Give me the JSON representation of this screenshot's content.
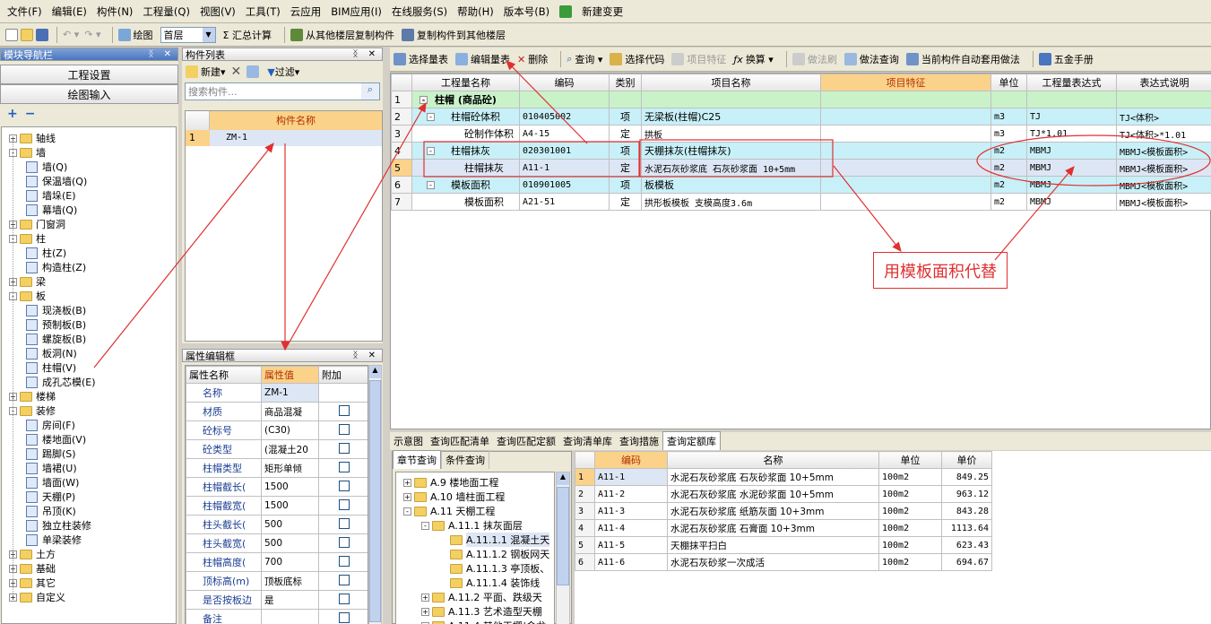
{
  "menu": {
    "items": [
      "文件(F)",
      "编辑(E)",
      "构件(N)",
      "工程量(Q)",
      "视图(V)",
      "工具(T)",
      "云应用",
      "BIM应用(I)",
      "在线服务(S)",
      "帮助(H)",
      "版本号(B)"
    ],
    "new_change": "新建变更"
  },
  "toolbar": {
    "draw": "绘图",
    "floor": "首层",
    "sum": "Σ 汇总计算",
    "copy_from": "从其他楼层复制构件",
    "copy_to": "复制构件到其他楼层"
  },
  "nav": {
    "title": "模块导航栏",
    "settings_btn": "工程设置",
    "draw_btn": "绘图输入",
    "tree": [
      {
        "label": "轴线",
        "level": 0,
        "type": "folder",
        "expander": "+"
      },
      {
        "label": "墙",
        "level": 0,
        "type": "folder",
        "expander": "-"
      },
      {
        "label": "墙(Q)",
        "level": 1,
        "type": "leaf"
      },
      {
        "label": "保温墙(Q)",
        "level": 1,
        "type": "leaf"
      },
      {
        "label": "墙垛(E)",
        "level": 1,
        "type": "leaf"
      },
      {
        "label": "幕墙(Q)",
        "level": 1,
        "type": "leaf"
      },
      {
        "label": "门窗洞",
        "level": 0,
        "type": "folder",
        "expander": "+"
      },
      {
        "label": "柱",
        "level": 0,
        "type": "folder",
        "expander": "-"
      },
      {
        "label": "柱(Z)",
        "level": 1,
        "type": "leaf"
      },
      {
        "label": "构造柱(Z)",
        "level": 1,
        "type": "leaf"
      },
      {
        "label": "梁",
        "level": 0,
        "type": "folder",
        "expander": "+"
      },
      {
        "label": "板",
        "level": 0,
        "type": "folder",
        "expander": "-"
      },
      {
        "label": "现浇板(B)",
        "level": 1,
        "type": "leaf"
      },
      {
        "label": "预制板(B)",
        "level": 1,
        "type": "leaf"
      },
      {
        "label": "螺旋板(B)",
        "level": 1,
        "type": "leaf"
      },
      {
        "label": "板洞(N)",
        "level": 1,
        "type": "leaf"
      },
      {
        "label": "柱帽(V)",
        "level": 1,
        "type": "leaf"
      },
      {
        "label": "成孔芯模(E)",
        "level": 1,
        "type": "leaf"
      },
      {
        "label": "楼梯",
        "level": 0,
        "type": "folder",
        "expander": "+"
      },
      {
        "label": "装修",
        "level": 0,
        "type": "folder",
        "expander": "-"
      },
      {
        "label": "房间(F)",
        "level": 1,
        "type": "leaf"
      },
      {
        "label": "楼地面(V)",
        "level": 1,
        "type": "leaf"
      },
      {
        "label": "踢脚(S)",
        "level": 1,
        "type": "leaf"
      },
      {
        "label": "墙裙(U)",
        "level": 1,
        "type": "leaf"
      },
      {
        "label": "墙面(W)",
        "level": 1,
        "type": "leaf"
      },
      {
        "label": "天棚(P)",
        "level": 1,
        "type": "leaf"
      },
      {
        "label": "吊顶(K)",
        "level": 1,
        "type": "leaf"
      },
      {
        "label": "独立柱装修",
        "level": 1,
        "type": "leaf"
      },
      {
        "label": "单梁装修",
        "level": 1,
        "type": "leaf"
      },
      {
        "label": "土方",
        "level": 0,
        "type": "folder",
        "expander": "+"
      },
      {
        "label": "基础",
        "level": 0,
        "type": "folder",
        "expander": "+"
      },
      {
        "label": "其它",
        "level": 0,
        "type": "folder",
        "expander": "+"
      },
      {
        "label": "自定义",
        "level": 0,
        "type": "folder",
        "expander": "+"
      }
    ]
  },
  "component_list": {
    "title": "构件列表",
    "new": "新建",
    "filter": "过滤",
    "search_placeholder": "搜索构件...",
    "col_header": "构件名称",
    "rows": [
      {
        "idx": "1",
        "name": "ZM-1"
      }
    ]
  },
  "properties": {
    "title": "属性编辑框",
    "headers": [
      "属性名称",
      "属性值",
      "附加"
    ],
    "rows": [
      {
        "name": "名称",
        "value": "ZM-1",
        "check": false
      },
      {
        "name": "材质",
        "value": "商品混凝",
        "check": true
      },
      {
        "name": "砼标号",
        "value": "(C30)",
        "check": true
      },
      {
        "name": "砼类型",
        "value": "(混凝土20",
        "check": true
      },
      {
        "name": "柱帽类型",
        "value": "矩形单倾",
        "check": true
      },
      {
        "name": "柱帽截长(",
        "value": "1500",
        "check": true
      },
      {
        "name": "柱帽截宽(",
        "value": "1500",
        "check": true
      },
      {
        "name": "柱头截长(",
        "value": "500",
        "check": true
      },
      {
        "name": "柱头截宽(",
        "value": "500",
        "check": true
      },
      {
        "name": "柱帽高度(",
        "value": "700",
        "check": true
      },
      {
        "name": "顶标高(m)",
        "value": "顶板底标",
        "check": true
      },
      {
        "name": "是否按板边",
        "value": "是",
        "check": true
      },
      {
        "name": "备注",
        "value": "",
        "check": true
      }
    ]
  },
  "quantity_toolbar": {
    "select_list": "选择量表",
    "edit_list": "编辑量表",
    "delete": "删除",
    "query": "查询",
    "select_code": "选择代码",
    "item_feature": "项目特征",
    "convert": "换算",
    "format_brush": "做法刷",
    "method_query": "做法查询",
    "auto_apply": "当前构件自动套用做法",
    "hardware": "五金手册"
  },
  "quantity_table": {
    "headers": [
      "",
      "工程量名称",
      "编码",
      "类别",
      "项目名称",
      "项目特征",
      "单位",
      "工程量表达式",
      "表达式说明"
    ],
    "rows": [
      {
        "idx": "1",
        "name": "柱帽 (商品砼)",
        "code": "",
        "type": "",
        "item": "",
        "feature": "",
        "unit": "",
        "expr": "",
        "desc": "",
        "style": "group"
      },
      {
        "idx": "2",
        "name": "柱帽砼体积",
        "code": "010405002",
        "type": "项",
        "item": "无梁板(柱帽)C25",
        "feature": "",
        "unit": "m3",
        "expr": "TJ",
        "desc": "TJ<体积>",
        "style": "item"
      },
      {
        "idx": "3",
        "name": "砼制作体积",
        "code": "A4-15",
        "type": "定",
        "item": "拱板",
        "feature": "",
        "unit": "m3",
        "expr": "TJ*1.01",
        "desc": "TJ<体积>*1.01",
        "style": "quota"
      },
      {
        "idx": "4",
        "name": "柱帽抹灰",
        "code": "020301001",
        "type": "项",
        "item": "天棚抹灰(柱帽抹灰)",
        "feature": "",
        "unit": "m2",
        "expr": "MBMJ",
        "desc": "MBMJ<模板面积>",
        "style": "item"
      },
      {
        "idx": "5",
        "name": "柱帽抹灰",
        "code": "A11-1",
        "type": "定",
        "item": "水泥石灰砂浆底 石灰砂浆面 10+5mm",
        "feature": "",
        "unit": "m2",
        "expr": "MBMJ",
        "desc": "MBMJ<模板面积>",
        "style": "selected"
      },
      {
        "idx": "6",
        "name": "模板面积",
        "code": "010901005",
        "type": "项",
        "item": "板模板",
        "feature": "",
        "unit": "m2",
        "expr": "MBMJ",
        "desc": "MBMJ<模板面积>",
        "style": "item"
      },
      {
        "idx": "7",
        "name": "模板面积",
        "code": "A21-51",
        "type": "定",
        "item": "拱形板模板 支模高度3.6m",
        "feature": "",
        "unit": "m2",
        "expr": "MBMJ",
        "desc": "MBMJ<模板面积>",
        "style": "quota"
      }
    ]
  },
  "annotation": {
    "text": "用模板面积代替"
  },
  "bottom_tabs": [
    "示意图",
    "查询匹配清单",
    "查询匹配定额",
    "查询清单库",
    "查询措施",
    "查询定额库"
  ],
  "chapter": {
    "tabs": [
      "章节查询",
      "条件查询"
    ],
    "tree": [
      {
        "label": "A.9 楼地面工程",
        "level": 0,
        "expander": "+"
      },
      {
        "label": "A.10 墙柱面工程",
        "level": 0,
        "expander": "+"
      },
      {
        "label": "A.11 天棚工程",
        "level": 0,
        "expander": "-"
      },
      {
        "label": "A.11.1 抹灰面层",
        "level": 1,
        "expander": "-"
      },
      {
        "label": "A.11.1.1 混凝土天",
        "level": 2,
        "expander": "",
        "selected": true
      },
      {
        "label": "A.11.1.2 钢板网天",
        "level": 2,
        "expander": ""
      },
      {
        "label": "A.11.1.3 亭顶板、",
        "level": 2,
        "expander": ""
      },
      {
        "label": "A.11.1.4 装饰线",
        "level": 2,
        "expander": ""
      },
      {
        "label": "A.11.2 平面、跌级天",
        "level": 1,
        "expander": "+"
      },
      {
        "label": "A.11.3 艺术造型天棚",
        "level": 1,
        "expander": "+"
      },
      {
        "label": "A.11.4 其他天棚(金龙",
        "level": 1,
        "expander": "+"
      }
    ]
  },
  "quota_table": {
    "headers": [
      "",
      "编码",
      "名称",
      "单位",
      "单价"
    ],
    "rows": [
      {
        "idx": "1",
        "code": "A11-1",
        "name": "水泥石灰砂浆底 石灰砂浆面 10+5mm",
        "unit": "100m2",
        "price": "849.25"
      },
      {
        "idx": "2",
        "code": "A11-2",
        "name": "水泥石灰砂浆底 水泥砂浆面 10+5mm",
        "unit": "100m2",
        "price": "963.12"
      },
      {
        "idx": "3",
        "code": "A11-3",
        "name": "水泥石灰砂浆底 纸筋灰面 10+3mm",
        "unit": "100m2",
        "price": "843.28"
      },
      {
        "idx": "4",
        "code": "A11-4",
        "name": "水泥石灰砂浆底 石膏面 10+3mm",
        "unit": "100m2",
        "price": "1113.64"
      },
      {
        "idx": "5",
        "code": "A11-5",
        "name": "天棚抹平扫白",
        "unit": "100m2",
        "price": "623.43"
      },
      {
        "idx": "6",
        "code": "A11-6",
        "name": "水泥石灰砂浆一次成活",
        "unit": "100m2",
        "price": "694.67"
      }
    ]
  },
  "colors": {
    "group_row": "#c9f2c9",
    "item_row": "#c8f0f8",
    "selected_row": "#dde6f4",
    "header_highlight": "#fbd28a",
    "annotation": "#e03030"
  }
}
